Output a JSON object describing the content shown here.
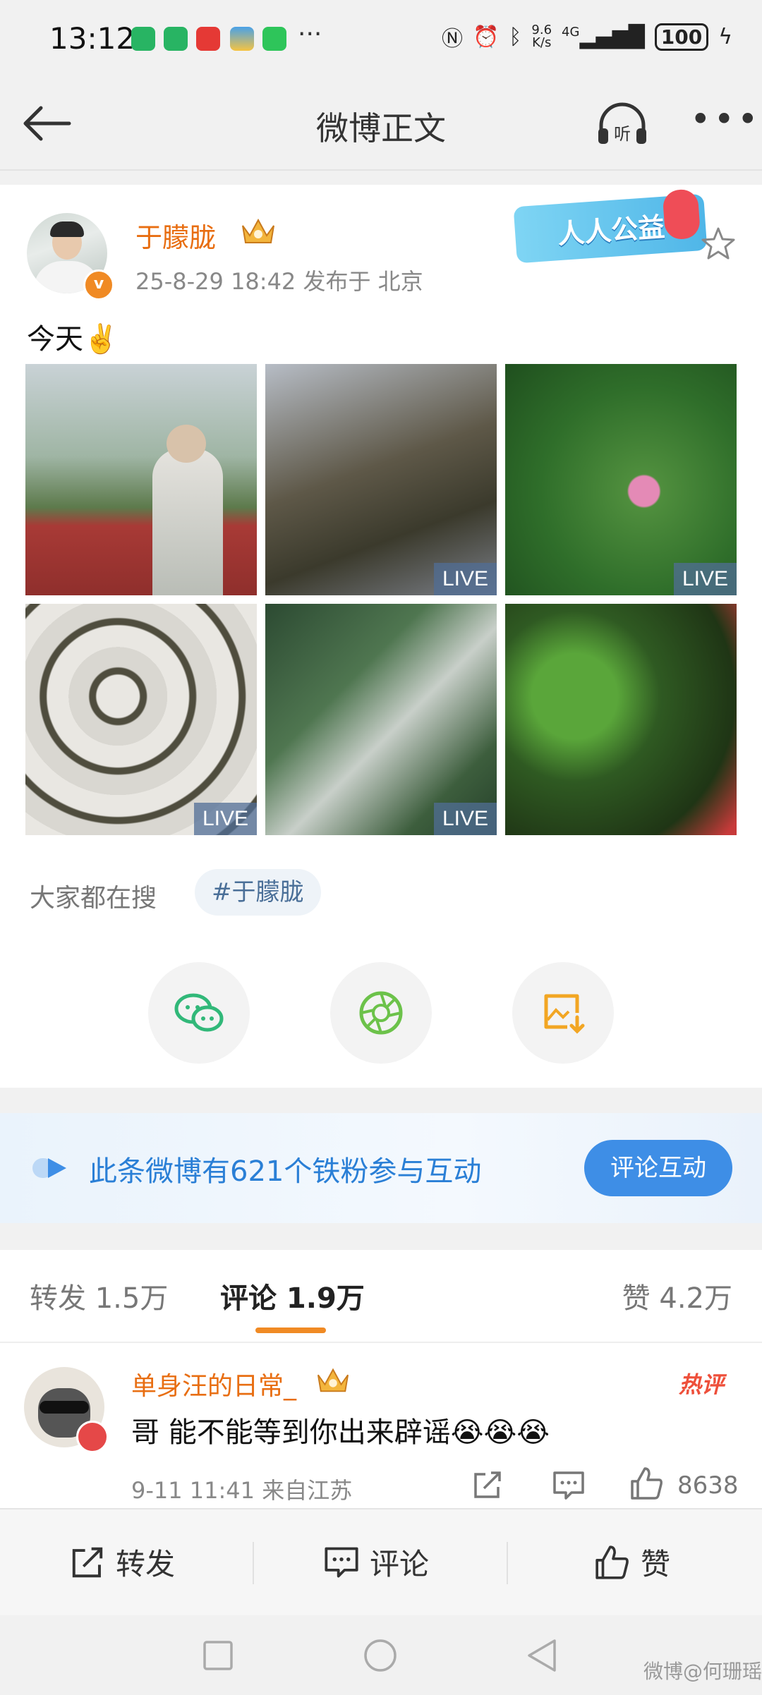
{
  "status_bar": {
    "time": "13:12",
    "more": "···",
    "network_speed_top": "9.6",
    "network_speed_bottom": "K/s",
    "signal": "4G",
    "battery": "100"
  },
  "header": {
    "title": "微博正文"
  },
  "post": {
    "username": "于朦胧",
    "time_location": "25-8-29 18:42   发布于 北京",
    "charity_badge": "人人公益",
    "text": "今天✌️",
    "photos": [
      {
        "id": "photo-1",
        "live": ""
      },
      {
        "id": "photo-2",
        "live": "LIVE"
      },
      {
        "id": "photo-3",
        "live": "LIVE"
      },
      {
        "id": "photo-4",
        "live": "LIVE"
      },
      {
        "id": "photo-5",
        "live": "LIVE"
      },
      {
        "id": "photo-6",
        "live": ""
      }
    ],
    "search_label": "大家都在搜",
    "hashtag": "#于朦胧"
  },
  "fans_bar": {
    "text": "此条微博有621个铁粉参与互动",
    "button": "评论互动"
  },
  "tabs": {
    "repost": "转发 1.5万",
    "comment": "评论 1.9万",
    "like": "赞 4.2万"
  },
  "comment": {
    "username": "单身汪的日常_",
    "hot_badge": "热评",
    "text": "哥 能不能等到你出来辟谣😭😭😭",
    "time_location": "9-11 11:41  来自江苏",
    "like_count": "8638"
  },
  "action_bar": {
    "repost": "转发",
    "comment": "评论",
    "like": "赞"
  },
  "watermark": "微博@何珊瑶"
}
